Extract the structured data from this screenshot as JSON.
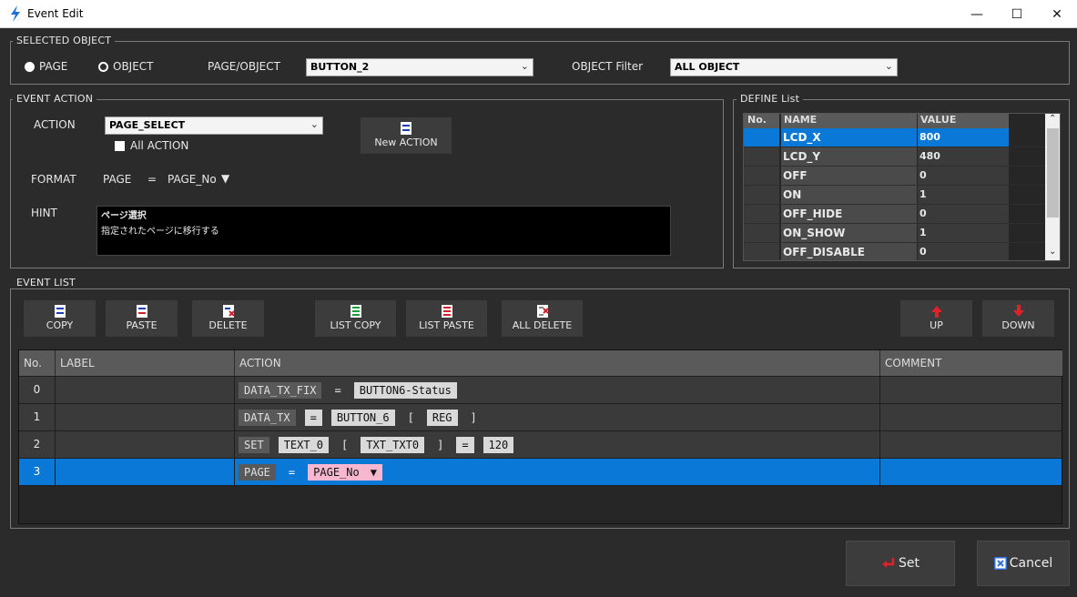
{
  "window": {
    "title": "Event Edit",
    "min_glyph": "—",
    "max_glyph": "☐",
    "close_glyph": "✕"
  },
  "selected_object": {
    "group_label": "SELECTED OBJECT",
    "radio_page": "PAGE",
    "radio_object": "OBJECT",
    "page_object_label": "PAGE/OBJECT",
    "page_object_value": "BUTTON_2",
    "filter_label": "OBJECT Filter",
    "filter_value": "ALL OBJECT"
  },
  "event_action": {
    "group_label": "EVENT ACTION",
    "action_label": "ACTION",
    "action_value": "PAGE_SELECT",
    "all_action_label": "All ACTION",
    "new_action_label": "New ACTION",
    "format_label": "FORMAT",
    "format_page": "PAGE",
    "format_eq": "=",
    "format_value": "PAGE_No",
    "hint_label": "HINT",
    "hint_title": "ページ選択",
    "hint_body": "指定されたページに移行する"
  },
  "define_list": {
    "group_label": "DEFINE List",
    "headers": [
      "No.",
      "NAME",
      "VALUE"
    ],
    "rows": [
      {
        "name": "LCD_X",
        "value": "800"
      },
      {
        "name": "LCD_Y",
        "value": "480"
      },
      {
        "name": "OFF",
        "value": "0"
      },
      {
        "name": "ON",
        "value": "1"
      },
      {
        "name": "OFF_HIDE",
        "value": "0"
      },
      {
        "name": "ON_SHOW",
        "value": "1"
      },
      {
        "name": "OFF_DISABLE",
        "value": "0"
      }
    ]
  },
  "event_list": {
    "group_label": "EVENT LIST",
    "buttons": {
      "copy": "COPY",
      "paste": "PASTE",
      "delete": "DELETE",
      "list_copy": "LIST COPY",
      "list_paste": "LIST PASTE",
      "all_delete": "ALL DELETE",
      "up": "UP",
      "down": "DOWN"
    },
    "headers": [
      "No.",
      "LABEL",
      "ACTION",
      "COMMENT"
    ],
    "rows": [
      {
        "no": "0",
        "tokens": [
          "DATA_TX_FIX",
          "=",
          "BUTTON6-Status"
        ]
      },
      {
        "no": "1",
        "tokens": [
          "DATA_TX",
          "=",
          "BUTTON_6",
          "[",
          "REG",
          "]"
        ]
      },
      {
        "no": "2",
        "tokens": [
          "SET",
          "TEXT_0",
          "[",
          "TXT_TXT0",
          "]",
          "=",
          "120"
        ]
      },
      {
        "no": "3",
        "tokens": [
          "PAGE",
          "=",
          "PAGE_No"
        ]
      }
    ]
  },
  "footer": {
    "set_label": "Set",
    "cancel_label": "Cancel"
  },
  "colors": {
    "background": "#2b2b2b",
    "selection": "#0a78d7",
    "token_pink": "#f7b8cf",
    "arrow_red": "#e0202a"
  }
}
